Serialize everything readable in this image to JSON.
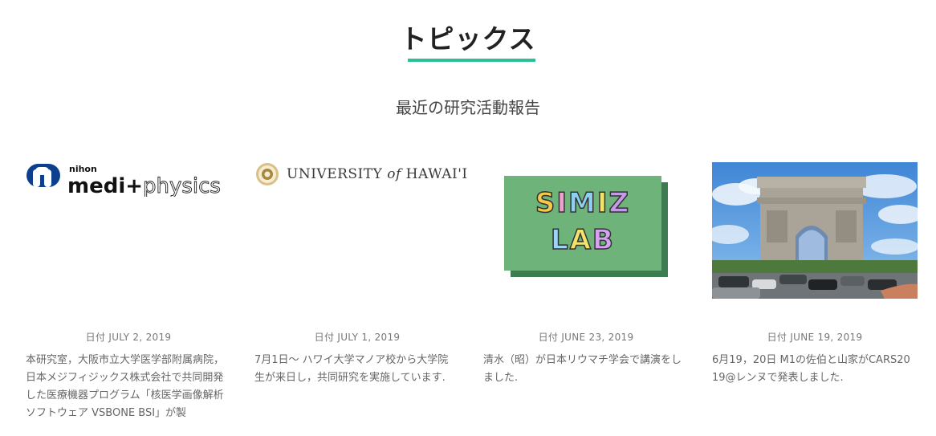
{
  "section": {
    "title": "トピックス",
    "subtitle": "最近の研究活動報告",
    "accent_color": "#2bbf9a"
  },
  "cards": [
    {
      "image": {
        "kind": "logo",
        "icon": "nihon-medi-physics-logo",
        "logo_text": {
          "small": "nihon",
          "main_bold": "medi+",
          "main_light": "physics"
        }
      },
      "date": "日付 JULY 2, 2019",
      "text": "本研究室，大阪市立大学医学部附属病院，日本メジフィジックス株式会社で共同開発した医療機器プログラム「核医学画像解析ソフトウェア VSBONE BSI」が製"
    },
    {
      "image": {
        "kind": "logo",
        "icon": "university-of-hawaii-seal-logo",
        "logo_text": {
          "pre": "UNIVERSITY ",
          "of": "of",
          "post": " HAWAI'I"
        }
      },
      "date": "日付 JULY 1, 2019",
      "text": "7月1日～ ハワイ大学マノア校から大学院生が来日し，共同研究を実施しています."
    },
    {
      "image": {
        "kind": "logo",
        "icon": "simiz-lab-logo",
        "logo_text": {
          "line1": "SIMIZ",
          "line2": "LAB"
        }
      },
      "date": "日付 JUNE 23, 2019",
      "text": "清水（昭）が日本リウマチ学会で講演をしました."
    },
    {
      "image": {
        "kind": "photo",
        "icon": "arc-de-triomphe-photo"
      },
      "date": "日付 JUNE 19, 2019",
      "text": "6月19，20日 M1の佐伯と山家がCARS2019@レンヌで発表しました."
    }
  ]
}
